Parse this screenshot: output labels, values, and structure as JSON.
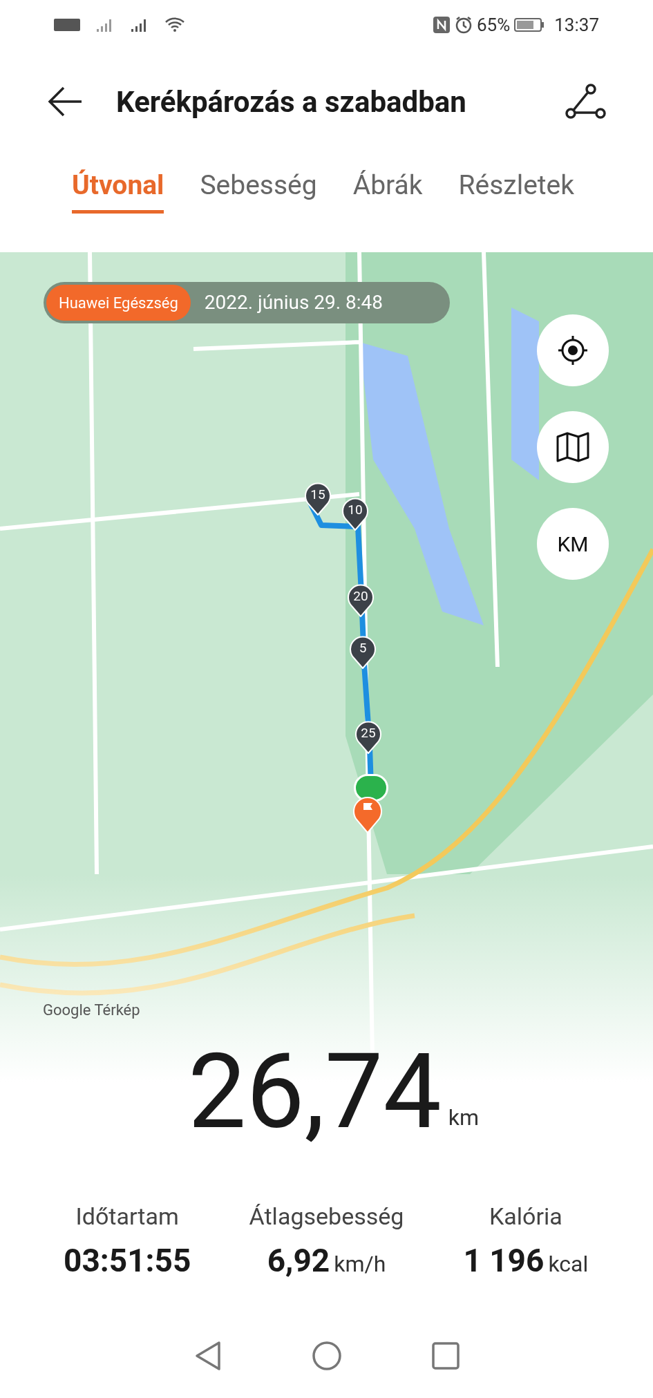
{
  "status_bar": {
    "battery": "65%",
    "time": "13:37"
  },
  "header": {
    "title": "Kerékpározás a szabadban"
  },
  "tabs": [
    {
      "label": "Útvonal",
      "selected": true
    },
    {
      "label": "Sebesség",
      "selected": false
    },
    {
      "label": "Ábrák",
      "selected": false
    },
    {
      "label": "Részletek",
      "selected": false
    }
  ],
  "map": {
    "source_badge": "Huawei Egészség",
    "date": "2022. június 29. 8:48",
    "unit_button": "KM",
    "attribution": "Google Térkép",
    "km_markers": [
      {
        "label": "15"
      },
      {
        "label": "10"
      },
      {
        "label": "20"
      },
      {
        "label": "5"
      },
      {
        "label": "25"
      }
    ]
  },
  "distance": {
    "value": "26,74",
    "unit": "km"
  },
  "stats": [
    {
      "label": "Időtartam",
      "value": "03:51:55"
    },
    {
      "label": "Átlagsebesség",
      "value": "6,92",
      "unit": "km/h"
    },
    {
      "label": "Kalória",
      "value": "1 196",
      "unit": "kcal"
    }
  ]
}
